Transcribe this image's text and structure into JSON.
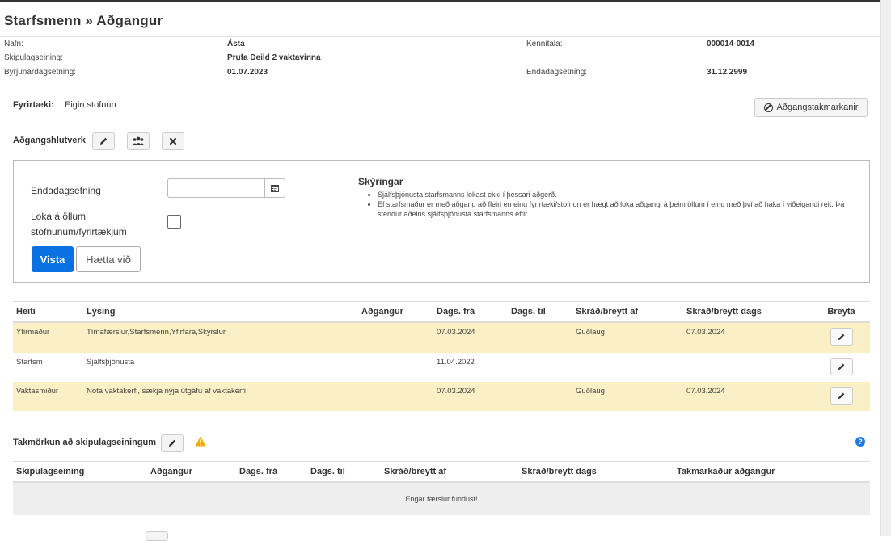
{
  "page": {
    "title": "Starfsmenn » Aðgangur"
  },
  "employee": {
    "name_label": "Nafn:",
    "name_value": "Ásta",
    "ssn_label": "Kennitala:",
    "ssn_value": "000014-0014",
    "unit_label": "Skipulagseining:",
    "unit_value": "Prufa Deild 2 vaktavinna",
    "start_label": "Byrjunardagsetning:",
    "start_value": "01.07.2023",
    "end_label": "Endadagsetning:",
    "end_value": "31.12.2999"
  },
  "company": {
    "label": "Fyrirtæki:",
    "value": "Eigin stofnun"
  },
  "restrictions_button": {
    "label": "Aðgangstakmarkanir",
    "icon": "ban-icon"
  },
  "roles": {
    "label": "Aðgangshlutverk",
    "icons": [
      "pencil-icon",
      "users-icon",
      "times-icon"
    ]
  },
  "form": {
    "enddate_label": "Endadagsetning",
    "enddate_value": "",
    "close_all_label": "Loka á öllum stofnunum/fyrirtækjum",
    "close_all_checked": false,
    "save_label": "Vista",
    "cancel_label": "Hætta við"
  },
  "explanation": {
    "title": "Skýringar",
    "items": [
      "Sjálfsþjónusta starfsmanns lokast ekki í þessari aðgerð.",
      "Ef starfsmaður er með aðgang að fleiri en einu fyrirtæki/stofnun er hægt að loka aðgangi á þeim öllum í einu með því að haka í viðeigandi reit. Þá stendur aðeins sjálfsþjónusta starfsmanns eftir."
    ]
  },
  "roles_table": {
    "columns": [
      "Heiti",
      "Lýsing",
      "Aðgangur",
      "Dags. frá",
      "Dags. til",
      "Skráð/breytt af",
      "Skráð/breytt dags",
      "Breyta"
    ],
    "rows": [
      {
        "name": "Yfirmaður",
        "description": "Tímafærslur,Starfsmenn,Yfirfara,Skýrslur",
        "access": "",
        "from": "07.03.2024",
        "to": "",
        "by": "Guðlaug",
        "date": "07.03.2024",
        "highlight": true
      },
      {
        "name": "Starfsm",
        "description": "Sjálfsþjónusta",
        "access": "",
        "from": "11.04.2022",
        "to": "",
        "by": "",
        "date": "",
        "highlight": false
      },
      {
        "name": "Vaktasmiður",
        "description": "Nota vaktakerfi, sækja nýja útgáfu af vaktakerfi",
        "access": "",
        "from": "07.03.2024",
        "to": "",
        "by": "Guðlaug",
        "date": "07.03.2024",
        "highlight": true
      }
    ]
  },
  "org_restrictions": {
    "label": "Takmörkun að skipulagseiningum",
    "warning_color": "#f0ad00",
    "help_color": "#1b7ae0",
    "columns": [
      "Skipulagseining",
      "Aðgangur",
      "Dags. frá",
      "Dags. til",
      "Skráð/breytt af",
      "Skráð/breytt dags",
      "Takmarkaður aðgangur"
    ],
    "empty_message": "Engar færslur fundust!"
  },
  "colors": {
    "primary": "#0a71e3",
    "highlight_row": "#fbefc5"
  }
}
